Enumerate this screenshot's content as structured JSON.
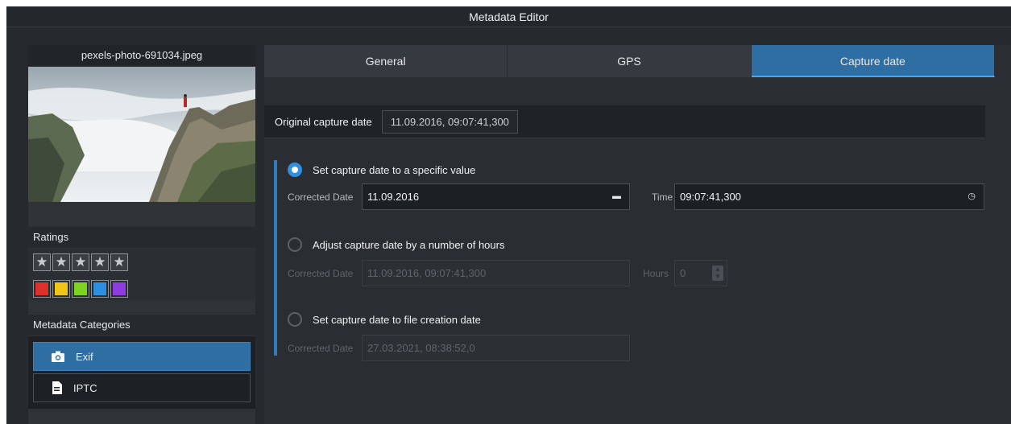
{
  "window": {
    "title": "Metadata Editor"
  },
  "left": {
    "filename": "pexels-photo-691034.jpeg",
    "ratings_label": "Ratings",
    "stars": [
      "★",
      "★",
      "★",
      "★",
      "★"
    ],
    "star_value": 0,
    "color_labels": [
      "#e0302b",
      "#f0c419",
      "#7ed321",
      "#2d8fe0",
      "#8e3ce0"
    ],
    "categories_label": "Metadata Categories",
    "categories": [
      {
        "label": "Exif",
        "icon": "camera-icon",
        "active": true
      },
      {
        "label": "IPTC",
        "icon": "document-icon",
        "active": false
      }
    ]
  },
  "tabs": [
    {
      "label": "General",
      "active": false
    },
    {
      "label": "GPS",
      "active": false
    },
    {
      "label": "Capture date",
      "active": true
    }
  ],
  "capture": {
    "original_label": "Original capture date",
    "original_value": "11.09.2016, 09:07:41,300",
    "options": [
      {
        "label": "Set capture date to a specific value",
        "selected": true,
        "corrected_label": "Corrected Date",
        "date_value": "11.09.2016",
        "time_label": "Time",
        "time_value": "09:07:41,300"
      },
      {
        "label": "Adjust capture date by a number of hours",
        "selected": false,
        "corrected_label": "Corrected Date",
        "date_value": "11.09.2016, 09:07:41,300",
        "hours_label": "Hours",
        "hours_value": "0"
      },
      {
        "label": "Set capture date to file creation date",
        "selected": false,
        "corrected_label": "Corrected Date",
        "date_value": "27.03.2021, 08:38:52,0"
      }
    ]
  },
  "colors": {
    "accent": "#2f6ea3",
    "highlight": "#2f8fe0",
    "background": "#262a2f"
  }
}
